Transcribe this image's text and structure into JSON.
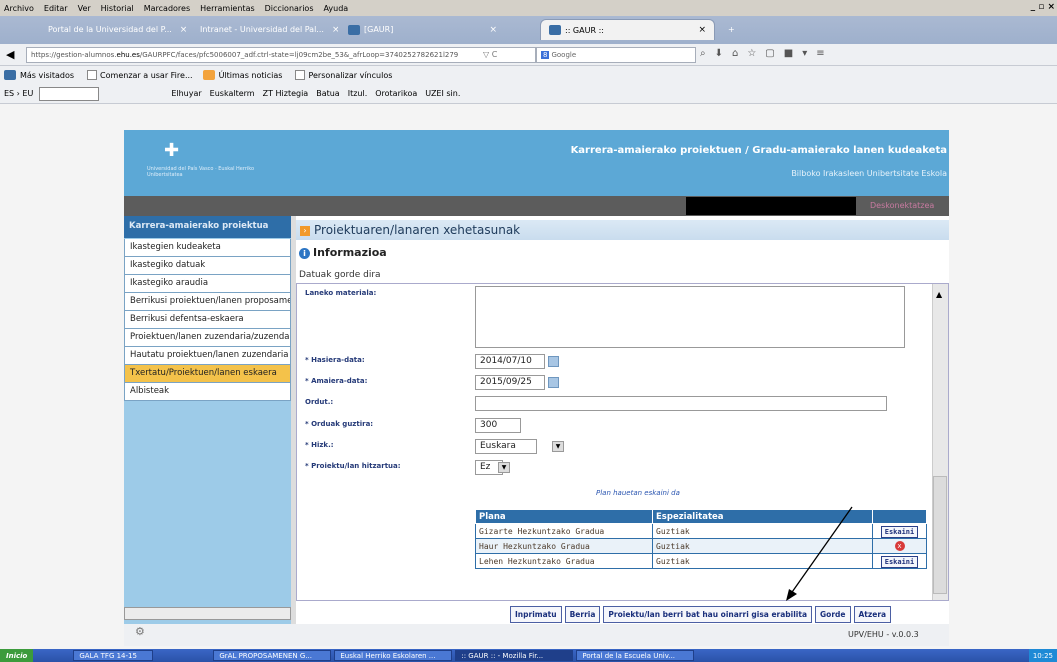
{
  "browser": {
    "menu": [
      "Archivo",
      "Editar",
      "Ver",
      "Historial",
      "Marcadores",
      "Herramientas",
      "Diccionarios",
      "Ayuda"
    ],
    "tabs": [
      "Portal de la Universidad del P...",
      "Intranet - Universidad del Pal...",
      "[GAUR]",
      ":: GAUR ::"
    ],
    "url_host": "https://gestion-alumnos.",
    "url_domain": "ehu.es",
    "url_path": "/GAURPFC/faces/pfc5006007_adf.ctrl-state=lj09cm2be_53&_afrLoop=3740252782621l279",
    "search_placeholder": "Google",
    "bookmarks": [
      "Más visitados",
      "Comenzar a usar Fire...",
      "Últimas noticias",
      "Personalizar vínculos"
    ],
    "lang_selector": "ES › EU",
    "lang_links": [
      "Elhuyar",
      "Euskalterm",
      "ZT Hiztegia",
      "Batua",
      "Itzul.",
      "Orotarikoa",
      "UZEI sin."
    ]
  },
  "header": {
    "title": "Karrera-amaierako proiektuen / Gradu-amaierako lanen kudeaketa",
    "subtitle": "Bilboko Irakasleen Unibertsitate Eskola",
    "logo_text1": "Universidad del País Vasco",
    "logo_text2": "Euskal Herriko Unibertsitatea",
    "logout": "Deskonektatzea"
  },
  "sidebar": {
    "title": "Karrera-amaierako proiektua",
    "items": [
      "Ikastegien kudeaketa",
      "Ikastegiko datuak",
      "Ikastegiko araudia",
      "Berrikusi proiektuen/lanen proposamenak",
      "Berrikusi defentsa-eskaera",
      "Proiektuen/lanen zuzendaria/zuzendariak",
      "Hautatu proiektuen/lanen zuzendaria",
      "Txertatu/Proiektuen/lanen eskaera",
      "Albisteak"
    ]
  },
  "main": {
    "title": "Proiektuaren/lanaren xehetasunak",
    "info_title": "Informazioa",
    "info_msg": "Datuak gorde dira",
    "labels": {
      "material": "Laneko materiala:",
      "start": "* Hasiera-data:",
      "end": "* Amaiera-data:",
      "hours": "Ordut.:",
      "total": "* Orduak guztira:",
      "lang": "* Hizk.:",
      "agreed": "* Proiektu/lan hitzartua:"
    },
    "values": {
      "start": "2014/07/10",
      "end": "2015/09/25",
      "hours": "",
      "total": "300",
      "lang": "Euskara",
      "agreed": "Ez"
    },
    "plan_hint": "Plan hauetan eskaini da",
    "table": {
      "headers": [
        "Plana",
        "Espezialitatea",
        ""
      ],
      "rows": [
        {
          "plan": "Gizarte Hezkuntzako Gradua",
          "spec": "Guztiak",
          "action": "Eskaini"
        },
        {
          "plan": "Haur Hezkuntzako Gradua",
          "spec": "Guztiak",
          "action": "x"
        },
        {
          "plan": "Lehen Hezkuntzako Gradua",
          "spec": "Guztiak",
          "action": "Eskaini"
        }
      ]
    },
    "buttons": [
      "Inprimatu",
      "Berria",
      "Proiektu/lan berri bat hau oinarri gisa erabilita",
      "Gorde",
      "Atzera"
    ]
  },
  "footer": {
    "version": "UPV/EHU - v.0.0.3"
  },
  "taskbar": {
    "start": "Inicio",
    "items": [
      "GALA TFG 14-15",
      "GrAL PROPOSAMENEN G...",
      "Euskal Herriko Eskolaren ...",
      ":: GAUR :: - Mozilla Fir...",
      "Portal de la Escuela Univ..."
    ],
    "clock": "10:25"
  }
}
